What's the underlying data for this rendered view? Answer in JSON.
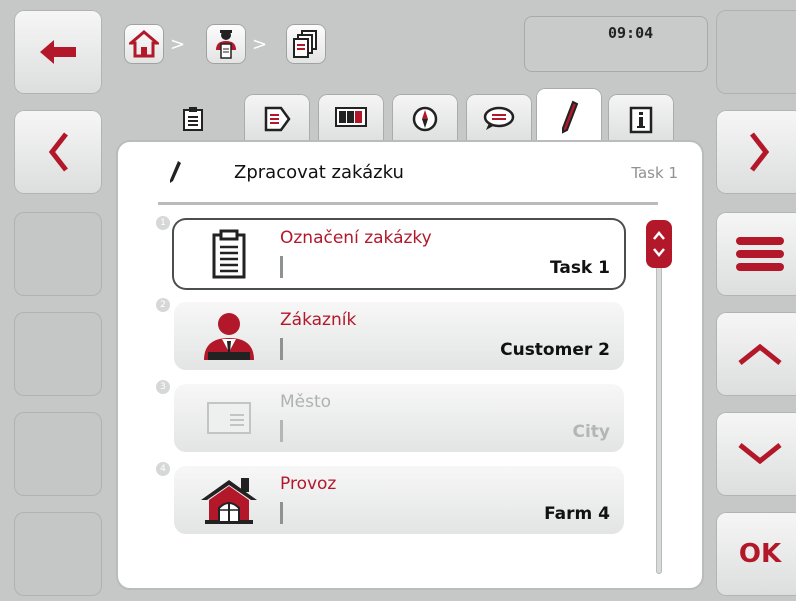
{
  "clock": "09:04",
  "breadcrumb": {
    "separator": ">",
    "items": [
      "home-icon",
      "operator-icon",
      "task-list-icon"
    ]
  },
  "tabs": [
    {
      "icon": "clipboard-icon",
      "active": false
    },
    {
      "icon": "document-forward-icon",
      "active": false
    },
    {
      "icon": "counter-icon",
      "active": false
    },
    {
      "icon": "compass-icon",
      "active": false
    },
    {
      "icon": "comment-icon",
      "active": false
    },
    {
      "icon": "pencil-icon",
      "active": true
    },
    {
      "icon": "info-icon",
      "active": false
    }
  ],
  "panel": {
    "title": "Zpracovat zakázku",
    "task": "Task 1"
  },
  "items": [
    {
      "number": "1",
      "label": "Označení zakázky",
      "value": "Task 1",
      "icon": "clipboard-icon",
      "selected": true,
      "disabled": false
    },
    {
      "number": "2",
      "label": "Zákazník",
      "value": "Customer 2",
      "icon": "customer-icon",
      "selected": false,
      "disabled": false
    },
    {
      "number": "3",
      "label": "Město",
      "value": "City",
      "icon": "envelope-icon",
      "selected": false,
      "disabled": true
    },
    {
      "number": "4",
      "label": "Provoz",
      "value": "Farm 4",
      "icon": "farm-icon",
      "selected": false,
      "disabled": false
    }
  ],
  "side": {
    "ok_label": "OK"
  },
  "colors": {
    "accent": "#b3182a",
    "background": "#c5c8c7"
  }
}
